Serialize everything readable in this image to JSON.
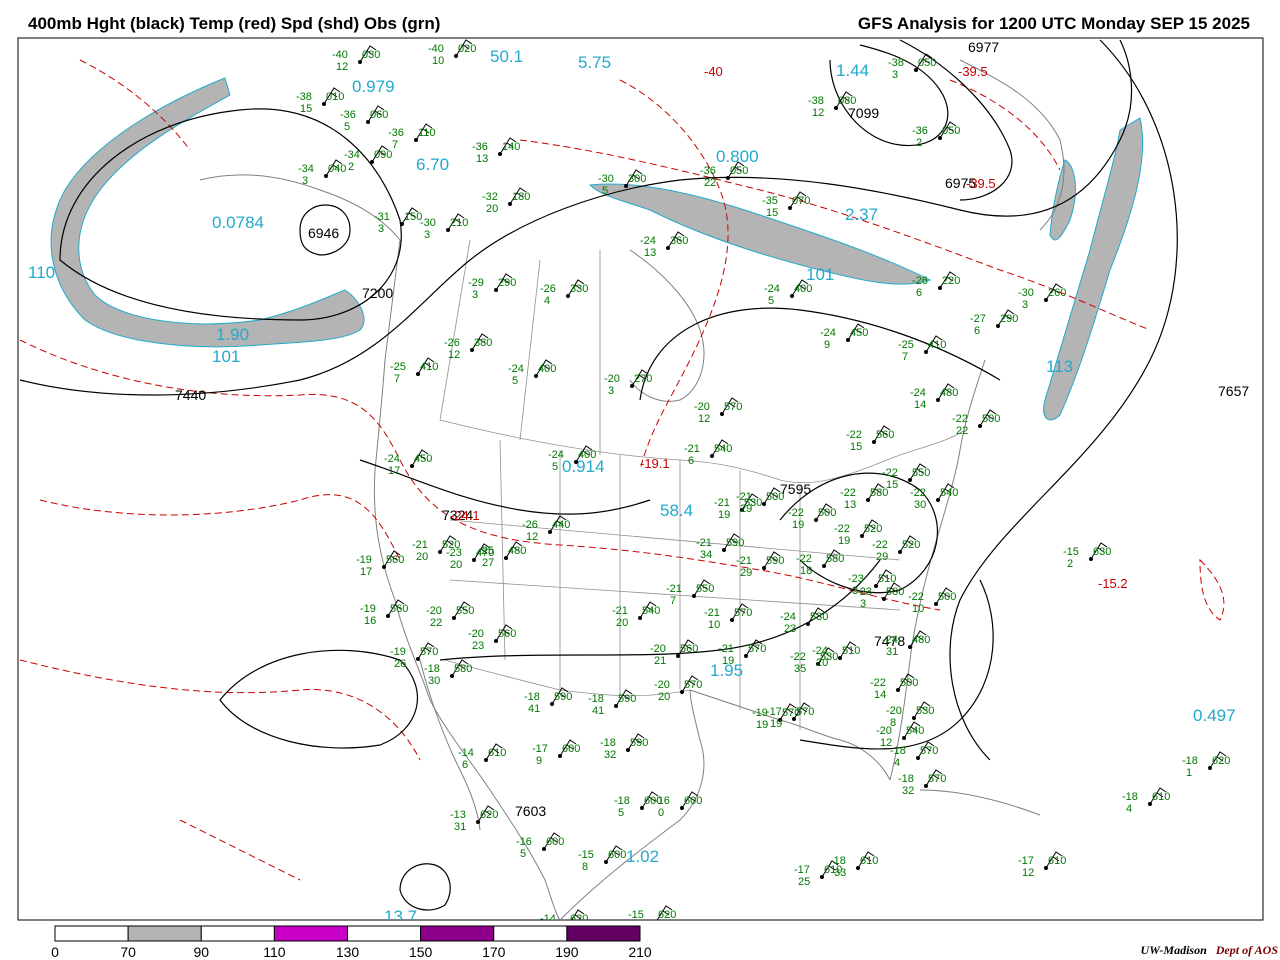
{
  "header": {
    "left_title": "400mb Hght (black) Temp (red) Spd (shd) Obs (grn)",
    "right_title": "GFS Analysis for 1200 UTC Monday  SEP 15 2025"
  },
  "footer": {
    "credit_org": "UW-Madison",
    "credit_dept": "Dept of AOS"
  },
  "colorbar": {
    "labels": [
      "0",
      "70",
      "90",
      "110",
      "130",
      "150",
      "170",
      "190",
      "210"
    ],
    "colors": [
      "#ffffff",
      "#b4b4b4",
      "#ffffff",
      "#c800c8",
      "#ffffff",
      "#8c008c",
      "#ffffff",
      "#640064"
    ]
  },
  "colors": {
    "height_contours": "#000000",
    "temperature_contours": "#c80000",
    "wind_speed_shading": "#b4b4b4",
    "observations": "#007800",
    "speed_labels": "#22aacc",
    "state_borders": "#808080"
  },
  "height_labels": [
    "7440",
    "7200",
    "6946",
    "7099",
    "6977",
    "6975",
    "7657",
    "7603",
    "7478",
    "7595",
    "7324"
  ],
  "speed_labels": [
    "0.979",
    "50.1",
    "5.75",
    "1.44",
    "6.70",
    "0.0784",
    "0.800",
    "2.37",
    "101",
    "1.90",
    "101",
    "0.914",
    "58.4",
    "1.95",
    "1.02",
    "0.497",
    "113",
    "110",
    "13.7"
  ],
  "temp_labels": [
    "-39.5",
    "-39.5",
    "-40",
    "-15.2",
    "-19.1",
    "-24.1"
  ],
  "observations": [
    {
      "t": "-40",
      "h": "030",
      "d": "12"
    },
    {
      "t": "-40",
      "h": "020",
      "d": "10"
    },
    {
      "t": "-38",
      "h": "010",
      "d": "15"
    },
    {
      "t": "-36",
      "h": "060",
      "d": "5"
    },
    {
      "t": "-36",
      "h": "110",
      "d": "7"
    },
    {
      "t": "-34",
      "h": "090",
      "d": "2"
    },
    {
      "t": "-34",
      "h": "040",
      "d": "3"
    },
    {
      "t": "-36",
      "h": "140",
      "d": "13"
    },
    {
      "t": "-32",
      "h": "180",
      "d": "20"
    },
    {
      "t": "-31",
      "h": "150",
      "d": "3"
    },
    {
      "t": "-30",
      "h": "210",
      "d": "3"
    },
    {
      "t": "-30",
      "h": "300",
      "d": "5"
    },
    {
      "t": "-29",
      "h": "290",
      "d": "3"
    },
    {
      "t": "-26",
      "h": "330",
      "d": "4"
    },
    {
      "t": "-24",
      "h": "360",
      "d": "13"
    },
    {
      "t": "-26",
      "h": "380",
      "d": "12"
    },
    {
      "t": "-24",
      "h": "400",
      "d": "5"
    },
    {
      "t": "-25",
      "h": "410",
      "d": "7"
    },
    {
      "t": "-24",
      "h": "450",
      "d": "17"
    },
    {
      "t": "-24",
      "h": "400",
      "d": "5"
    },
    {
      "t": "-20",
      "h": "570",
      "d": "12"
    },
    {
      "t": "-21",
      "h": "540",
      "d": "6"
    },
    {
      "t": "-20",
      "h": "270",
      "d": "3"
    },
    {
      "t": "-36",
      "h": "050",
      "d": "22"
    },
    {
      "t": "-35",
      "h": "070",
      "d": "15"
    },
    {
      "t": "-38",
      "h": "080",
      "d": "12"
    },
    {
      "t": "-38",
      "h": "050",
      "d": "3"
    },
    {
      "t": "-36",
      "h": "050",
      "d": "2"
    },
    {
      "t": "-26",
      "h": "220",
      "d": "6"
    },
    {
      "t": "-30",
      "h": "260",
      "d": "3"
    },
    {
      "t": "-27",
      "h": "290",
      "d": "6"
    },
    {
      "t": "-24",
      "h": "400",
      "d": "5"
    },
    {
      "t": "-24",
      "h": "450",
      "d": "9"
    },
    {
      "t": "-25",
      "h": "410",
      "d": "7"
    },
    {
      "t": "-24",
      "h": "480",
      "d": "14"
    },
    {
      "t": "-22",
      "h": "500",
      "d": "22"
    },
    {
      "t": "-22",
      "h": "560",
      "d": "15"
    },
    {
      "t": "-22",
      "h": "550",
      "d": "15"
    },
    {
      "t": "-22",
      "h": "580",
      "d": "13"
    },
    {
      "t": "-22",
      "h": "540",
      "d": "30"
    },
    {
      "t": "-21",
      "h": "530",
      "d": "19"
    },
    {
      "t": "-21",
      "h": "500",
      "d": "29"
    },
    {
      "t": "-22",
      "h": "500",
      "d": "19"
    },
    {
      "t": "-22",
      "h": "520",
      "d": "29"
    },
    {
      "t": "-22",
      "h": "520",
      "d": "19"
    },
    {
      "t": "-26",
      "h": "440",
      "d": "12"
    },
    {
      "t": "-23",
      "h": "470",
      "d": "20"
    },
    {
      "t": "-21",
      "h": "520",
      "d": "20"
    },
    {
      "t": "-25",
      "h": "480",
      "d": "27"
    },
    {
      "t": "-19",
      "h": "560",
      "d": "17"
    },
    {
      "t": "-19",
      "h": "560",
      "d": "16"
    },
    {
      "t": "-20",
      "h": "550",
      "d": "22"
    },
    {
      "t": "-20",
      "h": "560",
      "d": "23"
    },
    {
      "t": "-19",
      "h": "570",
      "d": "26"
    },
    {
      "t": "-18",
      "h": "580",
      "d": "30"
    },
    {
      "t": "-18",
      "h": "590",
      "d": "41"
    },
    {
      "t": "-18",
      "h": "590",
      "d": "41"
    },
    {
      "t": "-21",
      "h": "590",
      "d": "34"
    },
    {
      "t": "-21",
      "h": "590",
      "d": "29"
    },
    {
      "t": "-22",
      "h": "580",
      "d": "18"
    },
    {
      "t": "-21",
      "h": "550",
      "d": "7"
    },
    {
      "t": "-21",
      "h": "540",
      "d": "20"
    },
    {
      "t": "-21",
      "h": "570",
      "d": "10"
    },
    {
      "t": "-20",
      "h": "560",
      "d": "21"
    },
    {
      "t": "-20",
      "h": "570",
      "d": "20"
    },
    {
      "t": "-21",
      "h": "570",
      "d": "19"
    },
    {
      "t": "-24",
      "h": "530",
      "d": "23"
    },
    {
      "t": "-23",
      "h": "510",
      "d": "3"
    },
    {
      "t": "-23",
      "h": "500",
      "d": "3"
    },
    {
      "t": "-22",
      "h": "500",
      "d": "10"
    },
    {
      "t": "-22",
      "h": "530",
      "d": "35"
    },
    {
      "t": "-24",
      "h": "510",
      "d": "20"
    },
    {
      "t": "-24",
      "h": "480",
      "d": "31"
    },
    {
      "t": "-22",
      "h": "500",
      "d": "14"
    },
    {
      "t": "-20",
      "h": "530",
      "d": "8"
    },
    {
      "t": "-20",
      "h": "540",
      "d": "12"
    },
    {
      "t": "-18",
      "h": "570",
      "d": "4"
    },
    {
      "t": "-18",
      "h": "570",
      "d": "32"
    },
    {
      "t": "-19",
      "h": "570",
      "d": "19"
    },
    {
      "t": "-17",
      "h": "570",
      "d": "19"
    },
    {
      "t": "-14",
      "h": "610",
      "d": "6"
    },
    {
      "t": "-17",
      "h": "600",
      "d": "9"
    },
    {
      "t": "-18",
      "h": "590",
      "d": "32"
    },
    {
      "t": "-18",
      "h": "600",
      "d": "5"
    },
    {
      "t": "-16",
      "h": "600",
      "d": "0"
    },
    {
      "t": "-13",
      "h": "620",
      "d": "31"
    },
    {
      "t": "-16",
      "h": "600",
      "d": "5"
    },
    {
      "t": "-15",
      "h": "600",
      "d": "8"
    },
    {
      "t": "-17",
      "h": "610",
      "d": "25"
    },
    {
      "t": "-18",
      "h": "610",
      "d": "33"
    },
    {
      "t": "-17",
      "h": "610",
      "d": "12"
    },
    {
      "t": "-15",
      "h": "630",
      "d": "2"
    },
    {
      "t": "-18",
      "h": "620",
      "d": "1"
    },
    {
      "t": "-18",
      "h": "610",
      "d": "4"
    },
    {
      "t": "-14",
      "h": "620",
      "d": ""
    },
    {
      "t": "-15",
      "h": "620",
      "d": ""
    }
  ]
}
